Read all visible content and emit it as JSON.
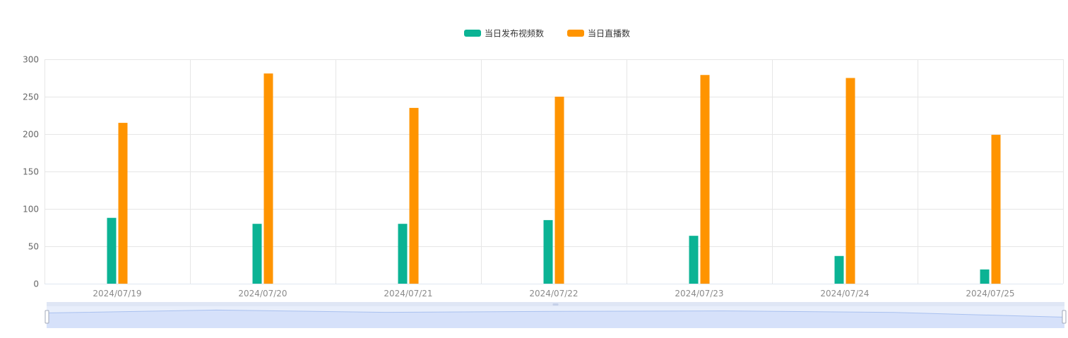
{
  "chart_data": {
    "type": "bar",
    "categories": [
      "2024/07/19",
      "2024/07/20",
      "2024/07/21",
      "2024/07/22",
      "2024/07/23",
      "2024/07/24",
      "2024/07/25"
    ],
    "series": [
      {
        "name": "当日发布视频数",
        "color": "#0bb394",
        "values": [
          88,
          80,
          80,
          85,
          64,
          37,
          19
        ]
      },
      {
        "name": "当日直播数",
        "color": "#ff9400",
        "values": [
          215,
          281,
          235,
          250,
          279,
          275,
          199
        ]
      }
    ],
    "ylim": [
      0,
      300
    ],
    "yticks": [
      0,
      50,
      100,
      150,
      200,
      250,
      300
    ],
    "grid": true,
    "legend_position": "top-center",
    "colors": {
      "grid": "#e6e6e6",
      "axis": "#e0e6f1",
      "datazoom_background": "#dfe6f5",
      "datazoom_fill": "#d6e1fa",
      "datazoom_line": "#a9c1f0"
    },
    "data_zoom": {
      "start_percent": 0,
      "end_percent": 100
    }
  }
}
